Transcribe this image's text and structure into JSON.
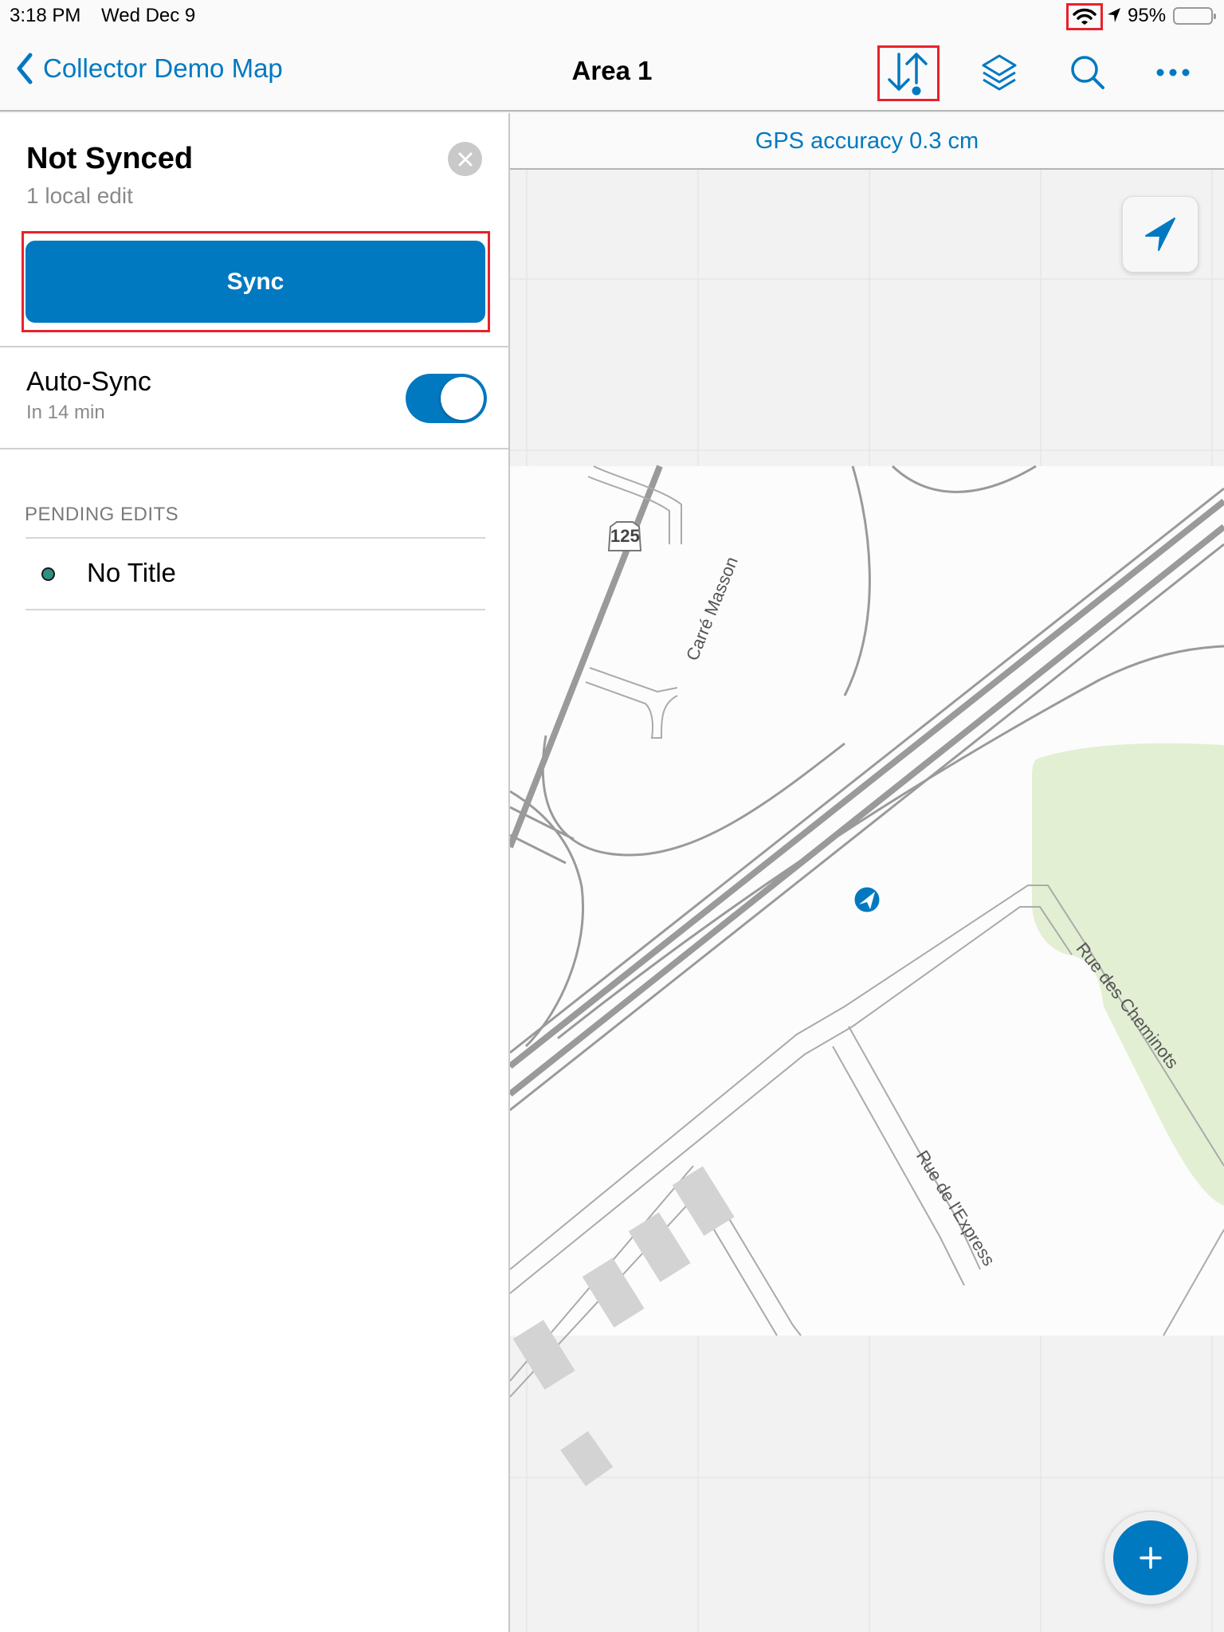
{
  "status_bar": {
    "time": "3:18 PM",
    "date": "Wed Dec 9",
    "battery_percent": "95%",
    "icons": [
      "wifi-icon",
      "location-arrow-icon",
      "battery-icon"
    ]
  },
  "nav_bar": {
    "back_label": "Collector Demo Map",
    "title": "Area 1",
    "icons": [
      "sync-icon",
      "layers-icon",
      "search-icon",
      "more-icon"
    ]
  },
  "sync_panel": {
    "title": "Not Synced",
    "subtitle": "1 local edit",
    "sync_button_label": "Sync",
    "auto_sync": {
      "label": "Auto-Sync",
      "subtitle": "In 14 min",
      "enabled": true
    },
    "pending_edits": {
      "header": "PENDING EDITS",
      "items": [
        {
          "title": "No Title",
          "symbol_color": "#2f8f83"
        }
      ]
    }
  },
  "map": {
    "gps_accuracy": "GPS accuracy 0.3 cm",
    "labels": {
      "route_shield": "125",
      "street_1": "Carré Masson",
      "street_2": "Rue des Cheminots",
      "street_3": "Rue de l'Express"
    },
    "colors": {
      "accent": "#0079c1",
      "highlight": "#e8222b",
      "park": "#e3efd3",
      "road": "#9a9a9a"
    }
  }
}
